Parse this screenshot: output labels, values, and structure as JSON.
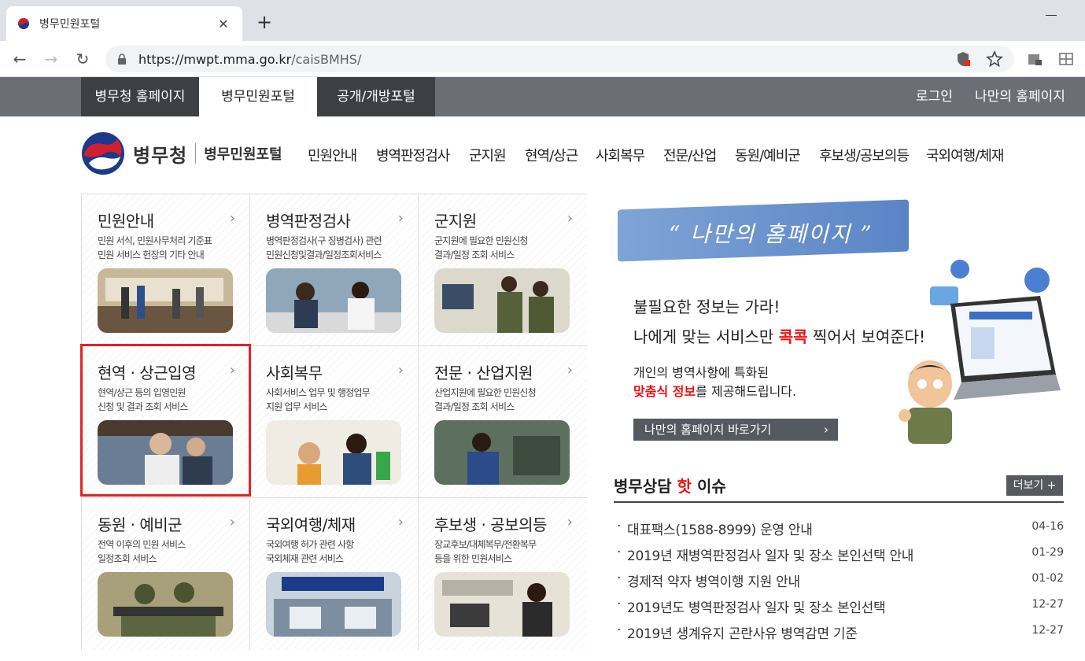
{
  "browser": {
    "tab_title": "병무민원포털",
    "url_host": "https://mwpt.mma.go.kr",
    "url_path": "/caisBMHS/"
  },
  "gnb": {
    "tabs": [
      "병무청 홈페이지",
      "병무민원포털",
      "공개/개방포털"
    ],
    "login": "로그인",
    "my_home": "나만의 홈페이지"
  },
  "logo": {
    "name": "병무청",
    "sub": "병무민원포털"
  },
  "menu": [
    "민원안내",
    "병역판정검사",
    "군지원",
    "현역/상근",
    "사회복무",
    "전문/산업",
    "동원/예비군",
    "후보생/공보의등",
    "국외여행/체재"
  ],
  "cells": [
    {
      "title": "민원안내",
      "desc1": "민원 서식, 민원사무처리 기준표",
      "desc2": "민원 서비스 헌장의 기타 안내"
    },
    {
      "title": "병역판정검사",
      "desc1": "병역판정검사(구 징병검사) 관련",
      "desc2": "민원신청및결과/일정조회서비스"
    },
    {
      "title": "군지원",
      "desc1": "군지원에 필요한 민원신청",
      "desc2": "결과/일정 조회 서비스"
    },
    {
      "title": "현역 · 상근입영",
      "desc1": "현역/상근 등의 입영민원",
      "desc2": "신청 및 결과 조회 서비스"
    },
    {
      "title": "사회복무",
      "desc1": "사회서비스 업무 및 행정업무",
      "desc2": "지원 업무 서비스"
    },
    {
      "title": "전문 · 산업지원",
      "desc1": "산업지원에 필요한 민원신청",
      "desc2": "결과/일정 조회 서비스"
    },
    {
      "title": "동원 · 예비군",
      "desc1": "전역 이후의 민원 서비스",
      "desc2": "일정조회 서비스"
    },
    {
      "title": "국외여행/체재",
      "desc1": "국외여행 허가 관련 사항",
      "desc2": "국외체재 관련 서비스"
    },
    {
      "title": "후보생 · 공보의등",
      "desc1": "장교후보/대체복무/전환복무",
      "desc2": "등을 위한 민원서비스"
    }
  ],
  "banner": {
    "ribbon": "“ 나만의 홈페이지 ”",
    "line1": "불필요한 정보는 가라!",
    "line2_a": "나에게 맞는 서비스만 ",
    "line2_red": "콕콕",
    "line2_b": " 찍어서 보여준다!",
    "line3": "개인의 병역사항에 특화된",
    "line4_red": "맞춤식 정보",
    "line4_b": "를 제공해드립니다.",
    "button": "나만의 홈페이지 바로가기"
  },
  "issues": {
    "title_a": "병무상담 ",
    "title_hot": "핫",
    "title_b": " 이슈",
    "more": "더보기 +",
    "items": [
      {
        "text": "대표팩스(1588-8999) 운영 안내",
        "date": "04-16"
      },
      {
        "text": "2019년 재병역판정검사 일자 및 장소 본인선택 안내",
        "date": "01-29"
      },
      {
        "text": "경제적 약자 병역이행 지원 안내",
        "date": "01-02"
      },
      {
        "text": "2019년도 병역판정검사 일자 및 장소 본인선택",
        "date": "12-27"
      },
      {
        "text": "2019년 생계유지 곤란사유 병역감면 기준",
        "date": "12-27"
      }
    ]
  }
}
